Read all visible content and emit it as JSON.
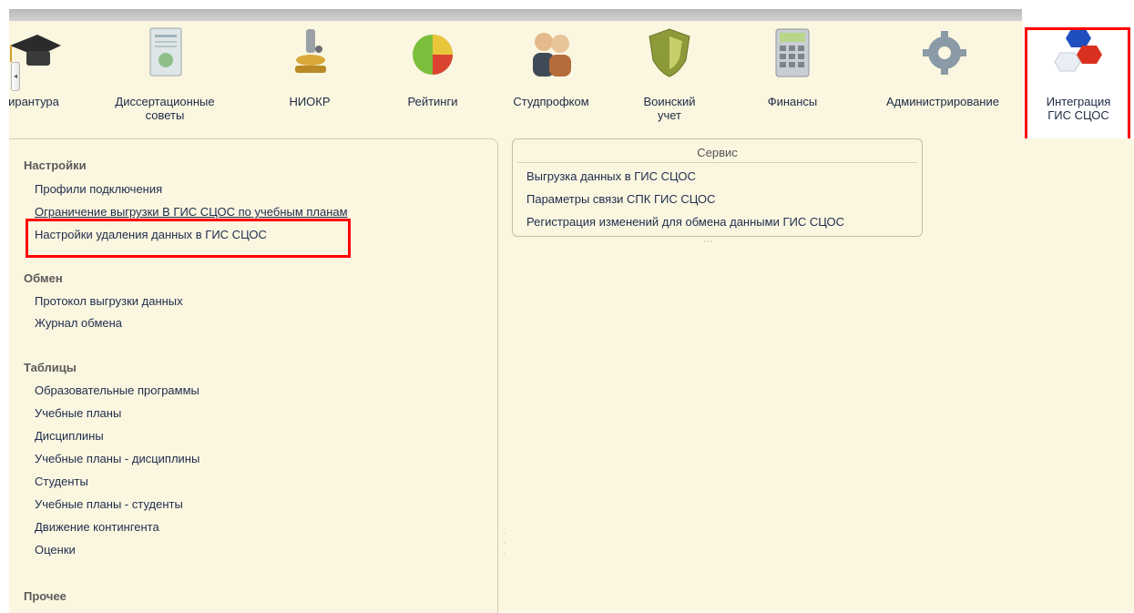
{
  "toolbar": {
    "items": [
      {
        "label": "ирантура",
        "icon": "graduation-cap-icon"
      },
      {
        "label": "Диссертационные\nсоветы",
        "icon": "certificate-icon"
      },
      {
        "label": "НИОКР",
        "icon": "microscope-icon"
      },
      {
        "label": "Рейтинги",
        "icon": "pie-chart-icon"
      },
      {
        "label": "Студпрофком",
        "icon": "people-icon"
      },
      {
        "label": "Воинский\nучет",
        "icon": "shield-icon"
      },
      {
        "label": "Финансы",
        "icon": "calculator-icon"
      },
      {
        "label": "Администрирование",
        "icon": "gears-icon"
      },
      {
        "label": "Интеграция\nГИС СЦОС",
        "icon": "cubes-icon"
      }
    ]
  },
  "left": {
    "settings": {
      "title": "Настройки",
      "items": [
        "Профили подключения",
        "Ограничение выгрузки В ГИС СЦОС по учебным планам",
        "Настройки удаления данных в ГИС СЦОС"
      ]
    },
    "exchange": {
      "title": "Обмен",
      "items": [
        "Протокол выгрузки данных",
        "Журнал обмена"
      ]
    },
    "tables": {
      "title": "Таблицы",
      "items": [
        "Образовательные программы",
        "Учебные планы",
        "Дисциплины",
        "Учебные планы - дисциплины",
        "Студенты",
        "Учебные планы - студенты",
        "Движение контингента",
        "Оценки"
      ]
    },
    "other": {
      "title": "Прочее"
    }
  },
  "service": {
    "title": "Сервис",
    "items": [
      "Выгрузка данных в ГИС СЦОС",
      "Параметры связи СПК ГИС СЦОС",
      "Регистрация изменений для обмена данными ГИС СЦОС"
    ]
  },
  "colors": {
    "highlight": "#ff0000",
    "panel": "#fbf6e0"
  }
}
